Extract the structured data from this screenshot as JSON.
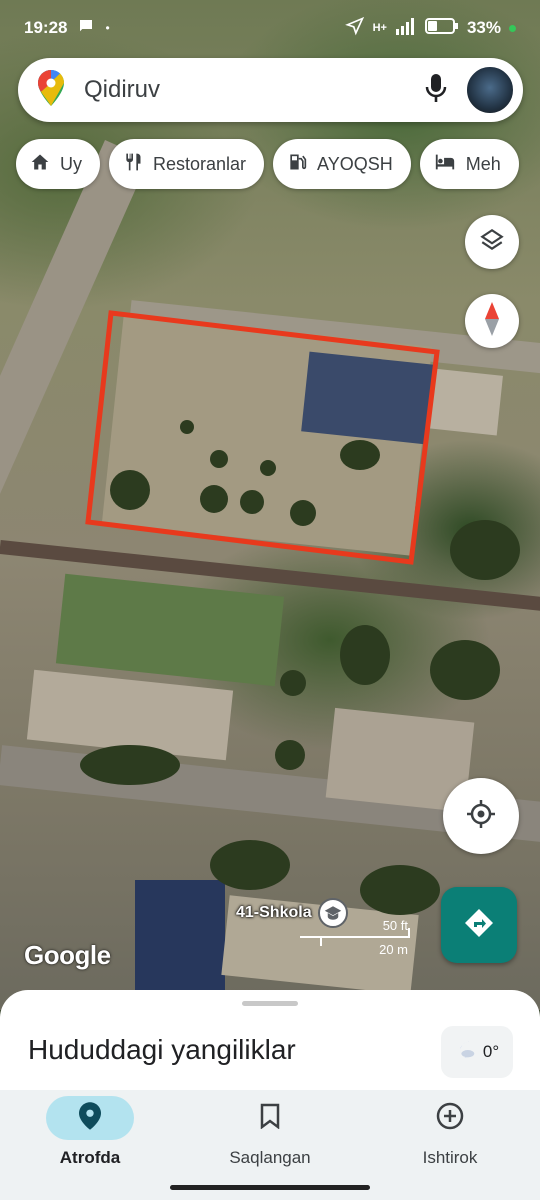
{
  "status_bar": {
    "time": "19:28",
    "network": "H+",
    "battery": "33%"
  },
  "search": {
    "placeholder": "Qidiruv",
    "mic_icon": "mic-icon",
    "account_icon": "account-avatar"
  },
  "chips": [
    {
      "label": "Uy",
      "icon": "home-icon"
    },
    {
      "label": "Restoranlar",
      "icon": "restaurant-icon"
    },
    {
      "label": "AYOQSH",
      "icon": "gas-station-icon"
    },
    {
      "label": "Meh",
      "icon": "hotel-icon"
    }
  ],
  "map": {
    "attribution": "Google",
    "poi_label": "41-Shkola",
    "scale_imperial": "50 ft",
    "scale_metric": "20 m",
    "highlight_color": "#e8391d"
  },
  "buttons": {
    "layers": "layers-icon",
    "compass": "compass-icon",
    "my_location": "my-location-icon",
    "directions": "directions-icon"
  },
  "sheet": {
    "title": "Hududdagi yangiliklar",
    "weather": "0°"
  },
  "nav": [
    {
      "label": "Atrofda",
      "icon": "location-pin-icon",
      "active": true
    },
    {
      "label": "Saqlangan",
      "icon": "bookmark-icon",
      "active": false
    },
    {
      "label": "Ishtirok",
      "icon": "add-circle-icon",
      "active": false
    }
  ],
  "colors": {
    "accent": "#0b7f76",
    "active_nav": "#b3e3ef"
  }
}
